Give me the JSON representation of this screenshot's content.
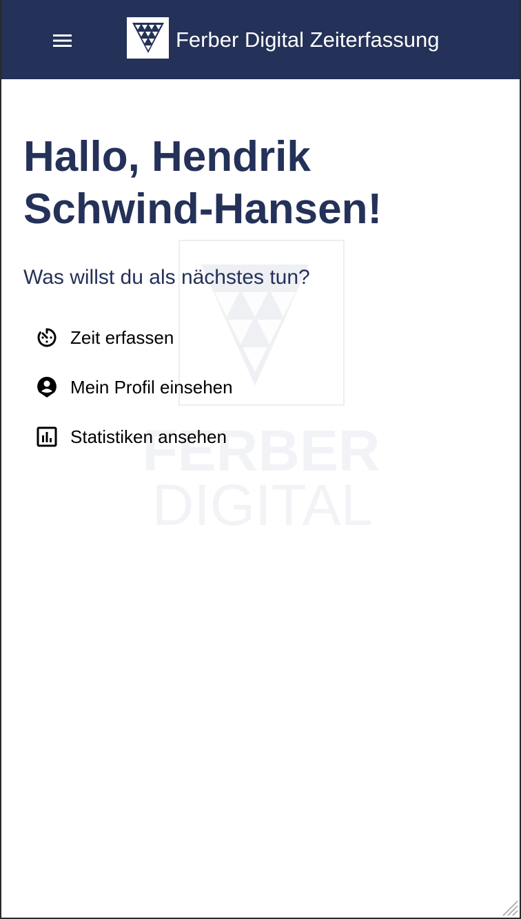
{
  "colors": {
    "appbar": "#243158",
    "heading": "#243158",
    "text": "#000000",
    "watermark": "#eef0f4"
  },
  "appbar": {
    "menu_icon": "hamburger-menu-icon",
    "logo_icon": "ferber-digital-logo-icon",
    "title": "Ferber Digital Zeiterfassung"
  },
  "watermark": {
    "line1": "FERBER",
    "line2": "DIGITAL"
  },
  "main": {
    "greeting": "Hallo, Hendrik Schwind-Hansen!",
    "prompt": "Was willst du als nächstes tun?",
    "actions": [
      {
        "icon": "timer-icon",
        "label": "Zeit erfassen"
      },
      {
        "icon": "account-circle-icon",
        "label": "Mein Profil einsehen"
      },
      {
        "icon": "bar-chart-icon",
        "label": "Statistiken ansehen"
      }
    ]
  }
}
